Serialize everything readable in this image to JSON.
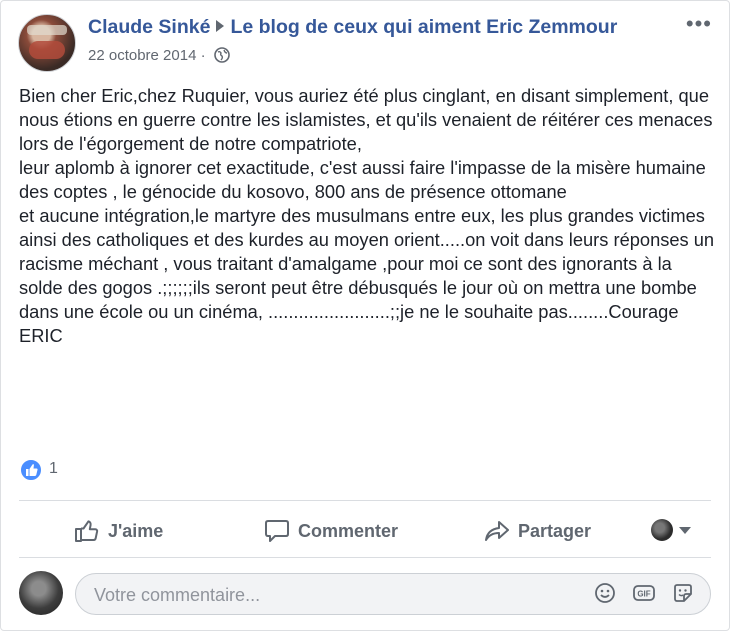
{
  "post": {
    "author": "Claude Sinké",
    "group": "Le blog de ceux qui aiment Eric Zemmour",
    "date": "22 octobre 2014",
    "separator": "·",
    "paragraphs": [
      "Bien cher Eric,chez Ruquier, vous auriez été plus cinglant, en disant simplement, que nous étions en guerre contre les islamistes, et qu'ils venaient de réitérer ces menaces lors de l'égorgement de notre compatriote,",
      "leur aplomb à ignorer cet exactitude, c'est aussi faire l'impasse de la misère humaine des coptes , le génocide du kosovo, 800 ans de présence ottomane",
      "et aucune intégration,le martyre des musulmans entre eux, les plus grandes victimes ainsi des catholiques et des kurdes au moyen orient.....on voit dans leurs réponses un racisme méchant , vous traitant d'amalgame ,pour moi ce sont des ignorants à la solde des gogos .;;;;;;ils seront peut être débusqués le jour où on mettra une bombe dans une école ou un cinéma, ........................;;je ne le souhaite pas........Courage ERIC"
    ],
    "reactions_count": "1"
  },
  "actions": {
    "like": "J'aime",
    "comment": "Commenter",
    "share": "Partager"
  },
  "comment_box": {
    "placeholder": "Votre commentaire..."
  },
  "icons": {
    "more": "more-options-icon",
    "privacy": "globe-icon",
    "like": "thumbs-up-icon",
    "comment": "speech-bubble-icon",
    "share": "share-arrow-icon",
    "emoji": "emoji-icon",
    "gif": "gif-icon",
    "sticker": "sticker-icon"
  },
  "colors": {
    "link": "#365899",
    "like_blue": "#4a8eff",
    "muted": "#606770"
  }
}
